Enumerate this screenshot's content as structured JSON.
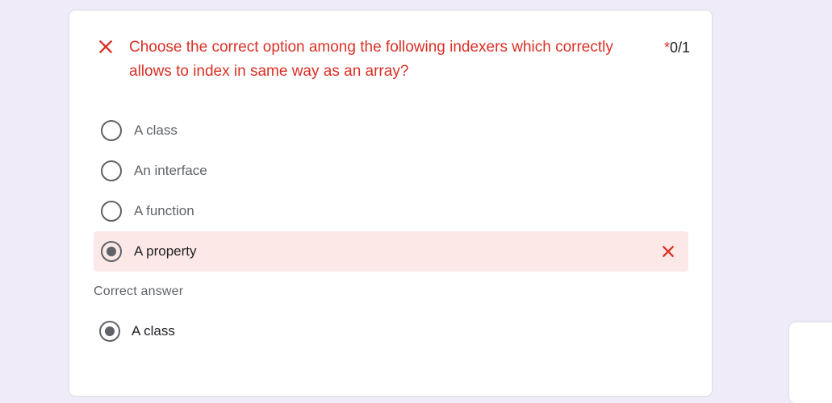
{
  "question": {
    "title": "Choose the correct option among the following indexers which correctly allows to index in same way as an array?",
    "required_marker": "*",
    "score": "0/1",
    "status_icon": "close-icon",
    "status_color": "#d93025"
  },
  "options": [
    {
      "label": "A class",
      "selected": false
    },
    {
      "label": "An interface",
      "selected": false
    },
    {
      "label": "A function",
      "selected": false
    },
    {
      "label": "A property",
      "selected": true,
      "result_icon": "close-icon"
    }
  ],
  "correct_answer": {
    "heading": "Correct answer",
    "label": "A class"
  },
  "colors": {
    "error": "#d93025",
    "wrong_background": "#fce8e6",
    "page_background": "#efebf8"
  }
}
